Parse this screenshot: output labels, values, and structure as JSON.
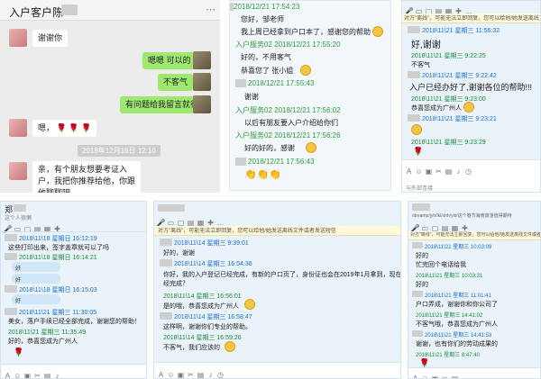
{
  "panel1": {
    "title": "入户客户陈",
    "messages": [
      {
        "text": "谢谢你"
      },
      {
        "text": "嗯嗯 可以的"
      },
      {
        "text": "不客气"
      },
      {
        "text": "有问题给我留言就行"
      },
      {
        "text": "嗯，"
      },
      {
        "text": "亲，有个朋友想要考证入户，我把你推荐给他，你跟他聊聊吧"
      }
    ],
    "timestamp": "2018年12月16日 12:10"
  },
  "panel2": {
    "lines": [
      {
        "kind": "name",
        "text": "2018/12/21 17:54:23"
      },
      {
        "kind": "txt",
        "text": "您好，邹老师"
      },
      {
        "kind": "txt",
        "text": "我上周已经拿到户口本了，感谢您的帮助"
      },
      {
        "kind": "name",
        "text": "入户服务02 2018/12/21 17:55:20"
      },
      {
        "kind": "txt",
        "text": "好的，不用客气"
      },
      {
        "kind": "txt",
        "text": "恭喜您了  张小姐"
      },
      {
        "kind": "name",
        "text": "2018/12/21 17:55:43"
      },
      {
        "kind": "txt",
        "text": "谢谢"
      },
      {
        "kind": "name",
        "text": "入户服务02 2018/12/21 17:56:02"
      },
      {
        "kind": "txt",
        "text": "以后有朋友要入户介绍给你们"
      },
      {
        "kind": "name",
        "text": "入户服务02 2018/12/21 17:56:26"
      },
      {
        "kind": "txt",
        "text": "好的好的，感谢"
      },
      {
        "kind": "name",
        "text": "2018/12/21 17:56:43"
      }
    ]
  },
  "panel3": {
    "notice": "对方\"离线\"，可能无法立即回复，您可以给他/她发送离线文件或者发送短信",
    "lines": [
      {
        "kind": "nb",
        "text": "2018\\11\\21 星期三 11:56:32"
      },
      {
        "kind": "big",
        "text": "好,谢谢"
      },
      {
        "kind": "nm",
        "text": "2018\\11\\21 星期三 9:22:25"
      },
      {
        "kind": "msg",
        "text": "不客气"
      },
      {
        "kind": "nb",
        "text": "2018\\11\\21 星期三 9:22:42"
      },
      {
        "kind": "big",
        "text": "入户已经办好了,谢谢各位的帮助!!!"
      },
      {
        "kind": "nm",
        "text": "2018\\11\\21 星期三 9:23:00"
      },
      {
        "kind": "msg",
        "text": "恭喜您成为广州人"
      },
      {
        "kind": "nb",
        "text": "2018\\11\\21 星期三 9:23:21"
      },
      {
        "kind": "nm",
        "text": "2018\\11\\21 星期三 9:23:29"
      }
    ],
    "footer": "与外部连接"
  },
  "panel4": {
    "title": "郑",
    "subtitle": "这个人很懒",
    "lines": [
      {
        "kind": "nb",
        "text": "2018\\11\\18 星期日 16:12:19"
      },
      {
        "kind": "msg",
        "text": "这些打印出来，签字盖章就可以了吗"
      },
      {
        "kind": "nm",
        "text": "2018\\11\\18 星期日 16:14:21"
      },
      {
        "kind": "nb",
        "text": "2018\\11\\18 星期日 16:15:03"
      },
      {
        "kind": "nb",
        "text": "2018\\11\\21 星期三 11:30:05"
      },
      {
        "kind": "msg",
        "text": "美女，落户手续已经全部完成，谢谢您的帮助！"
      },
      {
        "kind": "nm",
        "text": "2018\\11\\21 星期三 11:35:49"
      },
      {
        "kind": "msg",
        "text": "好的，恭喜您成为广州人"
      }
    ],
    "bubbles": [
      "好",
      "好",
      "好"
    ]
  },
  "panel5": {
    "notice": "对方\"离线\"，可能无法立即回复，您可以给他/她发送离线文件或者发送短信",
    "lines": [
      {
        "kind": "nb",
        "text": "2018\\11\\14 星期三 9:39:01"
      },
      {
        "kind": "msg",
        "text": "好的，谢谢"
      },
      {
        "kind": "nb",
        "text": "2018\\11\\14 星期三 16:54:36"
      },
      {
        "kind": "msg",
        "text": "你好，我的入户登记已经完成，有新的户口页了，身份证也会在2019年1月拿到，现在是不是整个流程已"
      },
      {
        "kind": "msg",
        "text": "经完成？"
      },
      {
        "kind": "nm",
        "text": "2018\\11\\14 星期三 16:56:01"
      },
      {
        "kind": "msg",
        "text": "是的哦，恭喜您成为广州人"
      },
      {
        "kind": "nb",
        "text": "2018\\11\\14 星期三 16:58:47"
      },
      {
        "kind": "msg",
        "text": "这样啊，谢谢你们专业的帮助。"
      },
      {
        "kind": "nm",
        "text": "2018\\11\\14 星期三 16:59:26"
      },
      {
        "kind": "msg",
        "text": "不客气，我们应该的"
      }
    ]
  },
  "panel6": {
    "title": "/dreamp/jyh/lkl/xhh/ylx/这个春节海南旅游值得期待",
    "notice": "对方\"离线\"，可能无法立即回复，您可以给他/她发送离线文件或者发送短信",
    "lines": [
      {
        "kind": "nb",
        "text": "2018\\11\\21 星期三 10:03:09"
      },
      {
        "kind": "msg",
        "text": "好的"
      },
      {
        "kind": "msg",
        "text": "忙完回个电话给我"
      },
      {
        "kind": "nm",
        "text": "2018\\11\\21 星期三 10:03:31"
      },
      {
        "kind": "msg",
        "text": "好的"
      },
      {
        "kind": "nb",
        "text": "2018\\11\\21 星期三 11:01:41"
      },
      {
        "kind": "msg",
        "text": "户口弄成，谢谢你和你公司了"
      },
      {
        "kind": "nm",
        "text": "2018\\11\\21 星期三 14:41:02"
      },
      {
        "kind": "msg",
        "text": "不客气哦，恭喜您成为广州人"
      },
      {
        "kind": "nb",
        "text": "2018\\11\\21 星期三 14:41:53"
      },
      {
        "kind": "msg",
        "text": "谢谢，也有你们的劳动成果的"
      },
      {
        "kind": "nm",
        "text": "2018\\11\\21 星期三 8:47:40"
      }
    ]
  }
}
